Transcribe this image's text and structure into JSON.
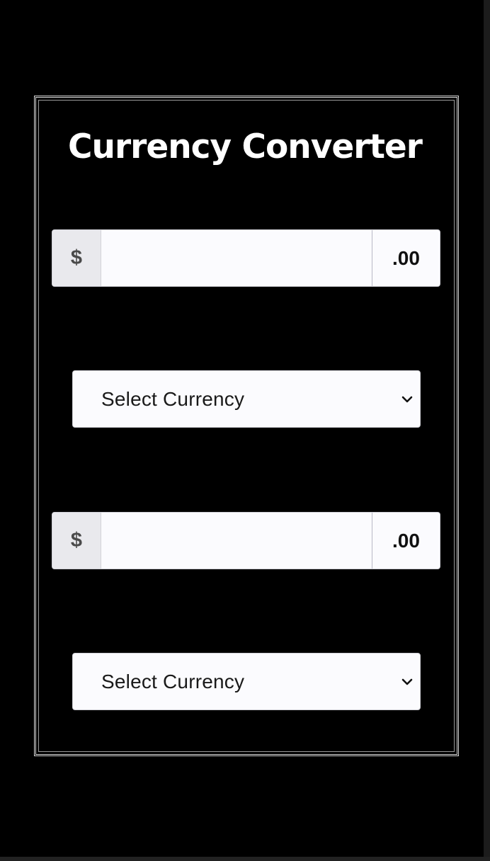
{
  "app": {
    "title": "Currency Converter"
  },
  "converter": {
    "from_amount": {
      "prefix": "$",
      "value": "",
      "suffix": ".00"
    },
    "from_currency": {
      "selected": "Select Currency"
    },
    "to_amount": {
      "prefix": "$",
      "value": "",
      "suffix": ".00"
    },
    "to_currency": {
      "selected": "Select Currency"
    }
  },
  "icons": {
    "dropdown": "chevron-down-icon"
  },
  "colors": {
    "background": "#000000",
    "text": "#ffffff",
    "field_background": "#fbfbfe",
    "addon_background": "#e9e9ed"
  }
}
